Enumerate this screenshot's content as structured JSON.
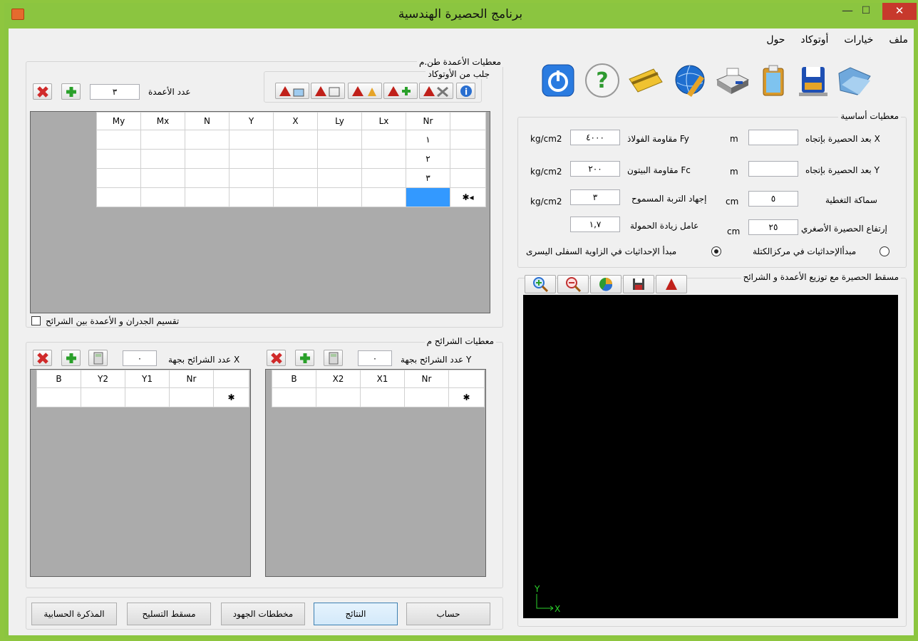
{
  "window": {
    "title": "برنامج الحصيرة الهندسية"
  },
  "menu": [
    "ملف",
    "خيارات",
    "أوتوكاد",
    "حول"
  ],
  "columns_group": {
    "title": "معطيات الأعمدة طن.م",
    "autocad_title": "جلب من الأوتوكاد",
    "count_label": "عدد الأعمدة",
    "count_value": "٣",
    "headers": [
      "My",
      "Mx",
      "N",
      "Y",
      "X",
      "Ly",
      "Lx",
      "Nr"
    ],
    "row_numbers": [
      "١",
      "٢",
      "٣"
    ],
    "new_row_marker": "✱◂",
    "split_label": "تقسيم الجدران و الأعمدة بين الشرائح"
  },
  "strips_group": {
    "title": "معطيات الشرائح م",
    "x_label": "عدد الشرائح بجهة X",
    "x_value": "٠",
    "y_label": "عدد الشرائح بجهة Y",
    "y_value": "٠",
    "x_headers": [
      "B",
      "Y2",
      "Y1",
      "Nr"
    ],
    "y_headers": [
      "B",
      "X2",
      "X1",
      "Nr"
    ],
    "new_row_marker": "✱"
  },
  "basic_group": {
    "title": "معطيات أساسية",
    "dim_x_label": "بعد الحصيرة بإتجاه X",
    "dim_x_unit": "m",
    "dim_x_value": "",
    "dim_y_label": "بعد الحصيرة بإتجاه Y",
    "dim_y_unit": "m",
    "dim_y_value": "",
    "cover_label": "سماكة التغطية",
    "cover_unit": "cm",
    "cover_value": "٥",
    "min_height_label": "إرتفاع الحصيرة الأصغري",
    "min_height_unit": "cm",
    "min_height_value": "٢٥",
    "fy_label": "مقاومة الفولاذ Fy",
    "fy_unit": "kg/cm2",
    "fy_value": "٤٠٠٠",
    "fc_label": "مقاومة البيتون Fc",
    "fc_unit": "kg/cm2",
    "fc_value": "٢٠٠",
    "soil_label": "إجهاد التربة المسموح",
    "soil_unit": "kg/cm2",
    "soil_value": "٣",
    "load_factor_label": "عامل زيادة الحمولة",
    "load_factor_value": "١,٧",
    "radio_centroid": "مبدأالإحداثيات في مركزالكتلة",
    "radio_corner": "مبدأ الإحداثيات في الزاوية السفلى اليسرى"
  },
  "plan_group": {
    "title": "مسقط الحصيرة مع توزيع الأعمدة و الشرائح",
    "axis_y": "Y",
    "axis_x": "X"
  },
  "buttons": {
    "calc": "حساب",
    "results": "النتائج",
    "force_diagrams": "مخططات الجهود",
    "reinforcement_plan": "مسقط التسليح",
    "report": "المذكرة الحسابية"
  },
  "colors": {
    "titlebar": "#8bc540",
    "close": "#c7392c",
    "canvas": "#000000",
    "selected_cell": "#3399ff"
  }
}
